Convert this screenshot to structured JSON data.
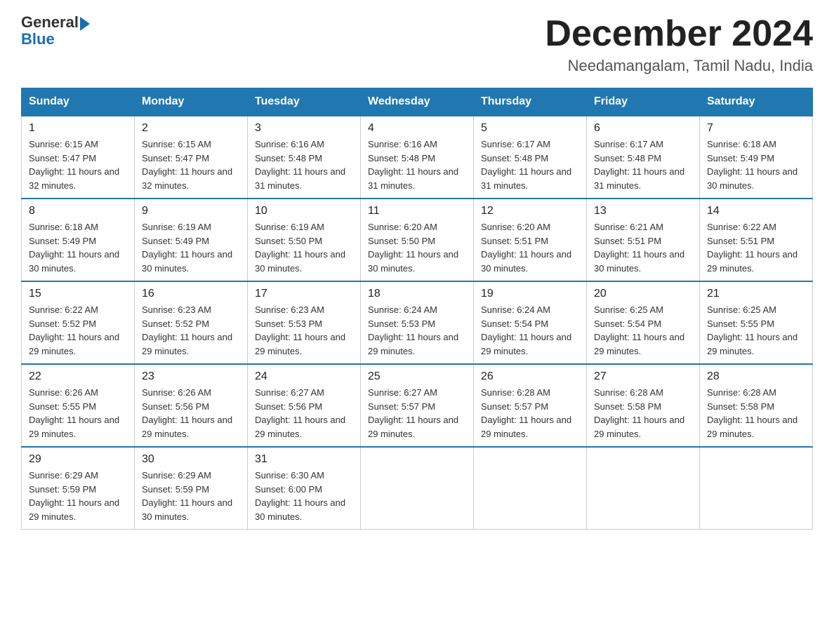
{
  "header": {
    "logo_text_general": "General",
    "logo_text_blue": "Blue",
    "title": "December 2024",
    "subtitle": "Needamangalam, Tamil Nadu, India"
  },
  "days_of_week": [
    "Sunday",
    "Monday",
    "Tuesday",
    "Wednesday",
    "Thursday",
    "Friday",
    "Saturday"
  ],
  "weeks": [
    [
      {
        "day": "1",
        "sunrise": "Sunrise: 6:15 AM",
        "sunset": "Sunset: 5:47 PM",
        "daylight": "Daylight: 11 hours and 32 minutes."
      },
      {
        "day": "2",
        "sunrise": "Sunrise: 6:15 AM",
        "sunset": "Sunset: 5:47 PM",
        "daylight": "Daylight: 11 hours and 32 minutes."
      },
      {
        "day": "3",
        "sunrise": "Sunrise: 6:16 AM",
        "sunset": "Sunset: 5:48 PM",
        "daylight": "Daylight: 11 hours and 31 minutes."
      },
      {
        "day": "4",
        "sunrise": "Sunrise: 6:16 AM",
        "sunset": "Sunset: 5:48 PM",
        "daylight": "Daylight: 11 hours and 31 minutes."
      },
      {
        "day": "5",
        "sunrise": "Sunrise: 6:17 AM",
        "sunset": "Sunset: 5:48 PM",
        "daylight": "Daylight: 11 hours and 31 minutes."
      },
      {
        "day": "6",
        "sunrise": "Sunrise: 6:17 AM",
        "sunset": "Sunset: 5:48 PM",
        "daylight": "Daylight: 11 hours and 31 minutes."
      },
      {
        "day": "7",
        "sunrise": "Sunrise: 6:18 AM",
        "sunset": "Sunset: 5:49 PM",
        "daylight": "Daylight: 11 hours and 30 minutes."
      }
    ],
    [
      {
        "day": "8",
        "sunrise": "Sunrise: 6:18 AM",
        "sunset": "Sunset: 5:49 PM",
        "daylight": "Daylight: 11 hours and 30 minutes."
      },
      {
        "day": "9",
        "sunrise": "Sunrise: 6:19 AM",
        "sunset": "Sunset: 5:49 PM",
        "daylight": "Daylight: 11 hours and 30 minutes."
      },
      {
        "day": "10",
        "sunrise": "Sunrise: 6:19 AM",
        "sunset": "Sunset: 5:50 PM",
        "daylight": "Daylight: 11 hours and 30 minutes."
      },
      {
        "day": "11",
        "sunrise": "Sunrise: 6:20 AM",
        "sunset": "Sunset: 5:50 PM",
        "daylight": "Daylight: 11 hours and 30 minutes."
      },
      {
        "day": "12",
        "sunrise": "Sunrise: 6:20 AM",
        "sunset": "Sunset: 5:51 PM",
        "daylight": "Daylight: 11 hours and 30 minutes."
      },
      {
        "day": "13",
        "sunrise": "Sunrise: 6:21 AM",
        "sunset": "Sunset: 5:51 PM",
        "daylight": "Daylight: 11 hours and 30 minutes."
      },
      {
        "day": "14",
        "sunrise": "Sunrise: 6:22 AM",
        "sunset": "Sunset: 5:51 PM",
        "daylight": "Daylight: 11 hours and 29 minutes."
      }
    ],
    [
      {
        "day": "15",
        "sunrise": "Sunrise: 6:22 AM",
        "sunset": "Sunset: 5:52 PM",
        "daylight": "Daylight: 11 hours and 29 minutes."
      },
      {
        "day": "16",
        "sunrise": "Sunrise: 6:23 AM",
        "sunset": "Sunset: 5:52 PM",
        "daylight": "Daylight: 11 hours and 29 minutes."
      },
      {
        "day": "17",
        "sunrise": "Sunrise: 6:23 AM",
        "sunset": "Sunset: 5:53 PM",
        "daylight": "Daylight: 11 hours and 29 minutes."
      },
      {
        "day": "18",
        "sunrise": "Sunrise: 6:24 AM",
        "sunset": "Sunset: 5:53 PM",
        "daylight": "Daylight: 11 hours and 29 minutes."
      },
      {
        "day": "19",
        "sunrise": "Sunrise: 6:24 AM",
        "sunset": "Sunset: 5:54 PM",
        "daylight": "Daylight: 11 hours and 29 minutes."
      },
      {
        "day": "20",
        "sunrise": "Sunrise: 6:25 AM",
        "sunset": "Sunset: 5:54 PM",
        "daylight": "Daylight: 11 hours and 29 minutes."
      },
      {
        "day": "21",
        "sunrise": "Sunrise: 6:25 AM",
        "sunset": "Sunset: 5:55 PM",
        "daylight": "Daylight: 11 hours and 29 minutes."
      }
    ],
    [
      {
        "day": "22",
        "sunrise": "Sunrise: 6:26 AM",
        "sunset": "Sunset: 5:55 PM",
        "daylight": "Daylight: 11 hours and 29 minutes."
      },
      {
        "day": "23",
        "sunrise": "Sunrise: 6:26 AM",
        "sunset": "Sunset: 5:56 PM",
        "daylight": "Daylight: 11 hours and 29 minutes."
      },
      {
        "day": "24",
        "sunrise": "Sunrise: 6:27 AM",
        "sunset": "Sunset: 5:56 PM",
        "daylight": "Daylight: 11 hours and 29 minutes."
      },
      {
        "day": "25",
        "sunrise": "Sunrise: 6:27 AM",
        "sunset": "Sunset: 5:57 PM",
        "daylight": "Daylight: 11 hours and 29 minutes."
      },
      {
        "day": "26",
        "sunrise": "Sunrise: 6:28 AM",
        "sunset": "Sunset: 5:57 PM",
        "daylight": "Daylight: 11 hours and 29 minutes."
      },
      {
        "day": "27",
        "sunrise": "Sunrise: 6:28 AM",
        "sunset": "Sunset: 5:58 PM",
        "daylight": "Daylight: 11 hours and 29 minutes."
      },
      {
        "day": "28",
        "sunrise": "Sunrise: 6:28 AM",
        "sunset": "Sunset: 5:58 PM",
        "daylight": "Daylight: 11 hours and 29 minutes."
      }
    ],
    [
      {
        "day": "29",
        "sunrise": "Sunrise: 6:29 AM",
        "sunset": "Sunset: 5:59 PM",
        "daylight": "Daylight: 11 hours and 29 minutes."
      },
      {
        "day": "30",
        "sunrise": "Sunrise: 6:29 AM",
        "sunset": "Sunset: 5:59 PM",
        "daylight": "Daylight: 11 hours and 30 minutes."
      },
      {
        "day": "31",
        "sunrise": "Sunrise: 6:30 AM",
        "sunset": "Sunset: 6:00 PM",
        "daylight": "Daylight: 11 hours and 30 minutes."
      },
      null,
      null,
      null,
      null
    ]
  ]
}
